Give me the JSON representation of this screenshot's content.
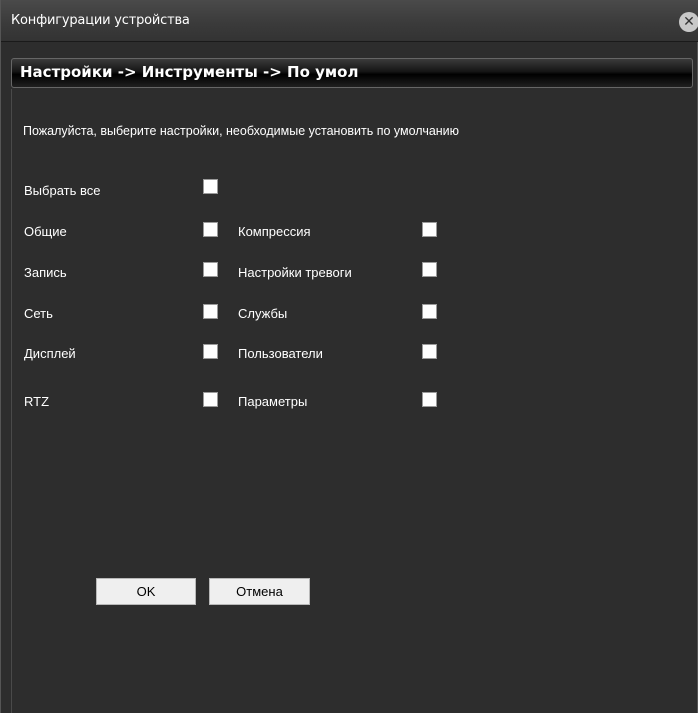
{
  "window": {
    "title": "Конфигурации устройства",
    "close_glyph": "✕"
  },
  "breadcrumb": {
    "text": "Настройки -> Инструменты -> По умол"
  },
  "instruction": "Пожалуйста, выберите настройки, необходимые установить по умолчанию",
  "select_all": {
    "label": "Выбрать все",
    "checked": false
  },
  "options_left": [
    {
      "label": "Общие",
      "checked": false
    },
    {
      "label": "Запись",
      "checked": false
    },
    {
      "label": "Сеть",
      "checked": false
    },
    {
      "label": "Дисплей",
      "checked": false
    },
    {
      "label": "RTZ",
      "checked": false
    }
  ],
  "options_right": [
    {
      "label": "Компрессия",
      "checked": false
    },
    {
      "label": "Настройки тревоги",
      "checked": false
    },
    {
      "label": "Службы",
      "checked": false
    },
    {
      "label": "Пользователи",
      "checked": false
    },
    {
      "label": "Параметры",
      "checked": false
    }
  ],
  "buttons": {
    "ok": "OK",
    "cancel": "Отмена"
  },
  "icons": {
    "close": "close-icon"
  }
}
